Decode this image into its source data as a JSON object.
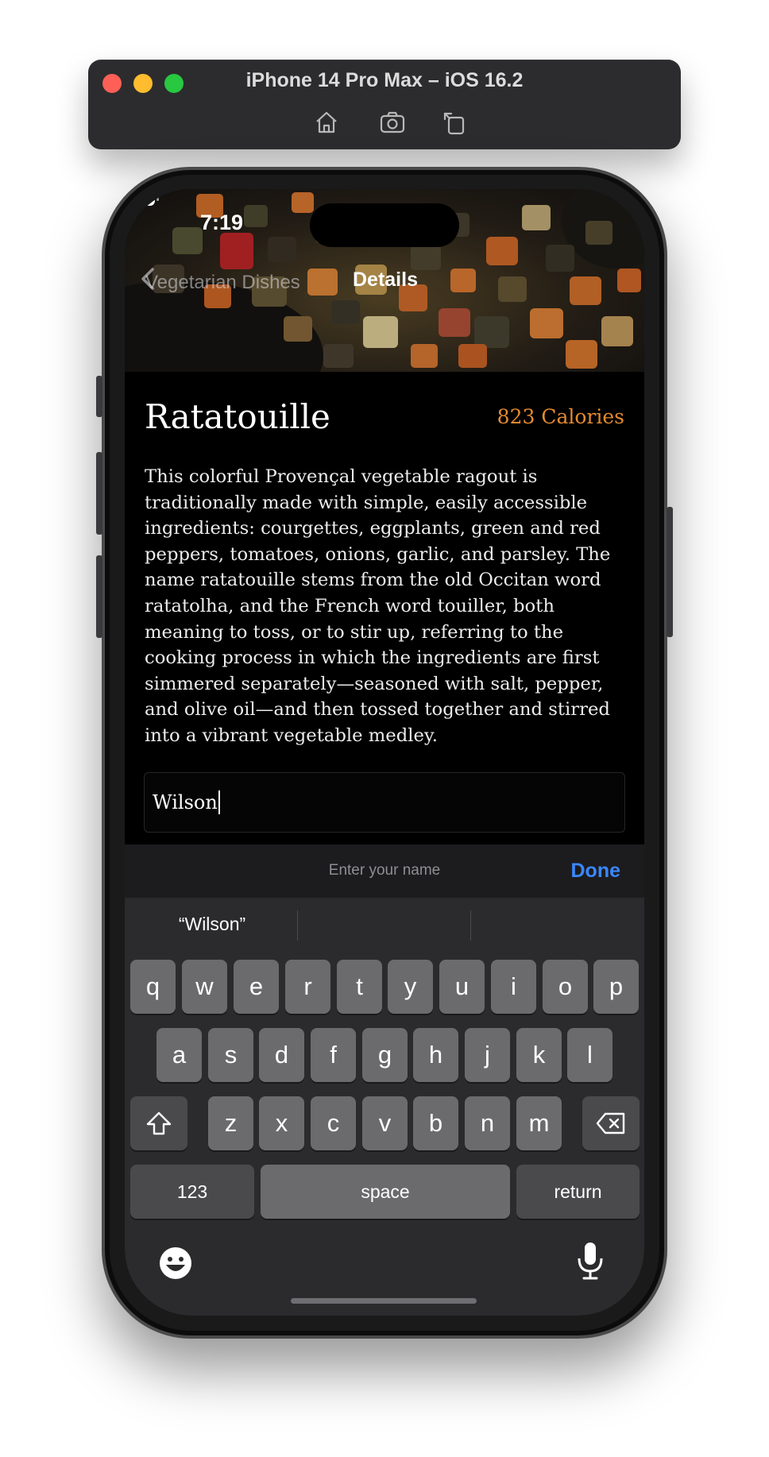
{
  "simulator": {
    "title": "iPhone 14 Pro Max – iOS 16.2",
    "toolbar_icons": [
      "home-icon",
      "screenshot-icon",
      "rotate-icon"
    ]
  },
  "status_bar": {
    "time": "7:19"
  },
  "nav": {
    "back_label": "Vegetarian Dishes",
    "title": "Details"
  },
  "recipe": {
    "name": "Ratatouille",
    "calories": "823 Calories",
    "description": "This colorful Provençal vegetable ragout is traditionally made with simple, easily accessible ingredients: courgettes, eggplants, green and red peppers, tomatoes, onions, garlic, and parsley. The name ratatouille stems from the old Occitan word ratatolha, and the French word touiller, both meaning to toss, or to stir up, referring to the cooking process in which the ingredients are first simmered separately—seasoned with salt, pepper, and olive oil—and then tossed together and stirred into a vibrant vegetable medley."
  },
  "name_field": {
    "value": "Wilson"
  },
  "accessory_bar": {
    "hint": "Enter your name",
    "done_label": "Done"
  },
  "keyboard": {
    "suggestion": "“Wilson”",
    "row1": [
      "q",
      "w",
      "e",
      "r",
      "t",
      "y",
      "u",
      "i",
      "o",
      "p"
    ],
    "row2": [
      "a",
      "s",
      "d",
      "f",
      "g",
      "h",
      "j",
      "k",
      "l"
    ],
    "row3": [
      "z",
      "x",
      "c",
      "v",
      "b",
      "n",
      "m"
    ],
    "numbers_label": "123",
    "space_label": "space",
    "return_label": "return"
  },
  "colors": {
    "accent_calories": "#e58a2f",
    "done_blue": "#3a87ff",
    "keyboard_bg": "#2b2b2d",
    "key_bg": "#6b6b6d"
  }
}
